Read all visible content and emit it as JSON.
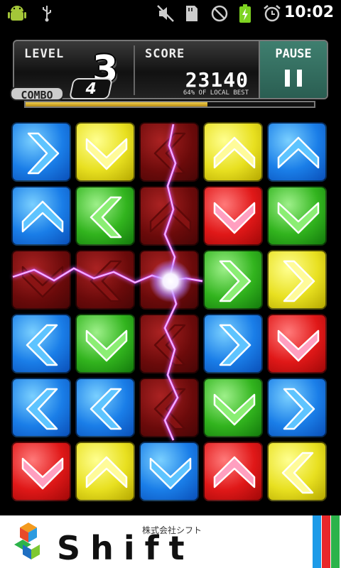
{
  "status_bar": {
    "time": "10:02",
    "icons": [
      "android-icon",
      "usb-icon",
      "mute-icon",
      "sd-card-icon",
      "no-sign-icon",
      "battery-charging-icon",
      "alarm-icon"
    ]
  },
  "hud": {
    "level_label": "LEVEL",
    "level_value": "3",
    "combo_label": "COMBO",
    "combo_value": "4",
    "score_label": "SCORE",
    "score_value": "23140",
    "best_text": "64% OF LOCAL BEST",
    "pause_label": "PAUSE",
    "progress": 0.63
  },
  "board": {
    "rows": [
      [
        {
          "color": "blue",
          "dir": "right"
        },
        {
          "color": "yellow",
          "dir": "down"
        },
        {
          "color": "dark",
          "dir": "left"
        },
        {
          "color": "yellow",
          "dir": "up"
        },
        {
          "color": "blue",
          "dir": "up"
        }
      ],
      [
        {
          "color": "blue",
          "dir": "up"
        },
        {
          "color": "green",
          "dir": "left"
        },
        {
          "color": "dark",
          "dir": "up"
        },
        {
          "color": "red",
          "dir": "down"
        },
        {
          "color": "green",
          "dir": "down"
        }
      ],
      [
        {
          "color": "dark",
          "dir": "down"
        },
        {
          "color": "dark",
          "dir": "left"
        },
        {
          "color": "dark",
          "dir": "none"
        },
        {
          "color": "green",
          "dir": "right"
        },
        {
          "color": "yellow",
          "dir": "right"
        }
      ],
      [
        {
          "color": "blue",
          "dir": "left"
        },
        {
          "color": "green",
          "dir": "down"
        },
        {
          "color": "dark",
          "dir": "left"
        },
        {
          "color": "blue",
          "dir": "right"
        },
        {
          "color": "red",
          "dir": "down"
        }
      ],
      [
        {
          "color": "blue",
          "dir": "left"
        },
        {
          "color": "blue",
          "dir": "left"
        },
        {
          "color": "dark",
          "dir": "left"
        },
        {
          "color": "green",
          "dir": "down"
        },
        {
          "color": "blue",
          "dir": "right"
        }
      ],
      [
        {
          "color": "red",
          "dir": "down"
        },
        {
          "color": "yellow",
          "dir": "up"
        },
        {
          "color": "blue",
          "dir": "down"
        },
        {
          "color": "red",
          "dir": "up"
        },
        {
          "color": "yellow",
          "dir": "left"
        }
      ]
    ]
  },
  "ad": {
    "company": "株式会社シフト",
    "brand": "Shift",
    "stripe_colors": [
      "#1e9be8",
      "#e8282a",
      "#2cb34a"
    ]
  },
  "colors": {
    "lightning": "#e060ff",
    "pause_bg": "#2f6e60"
  }
}
